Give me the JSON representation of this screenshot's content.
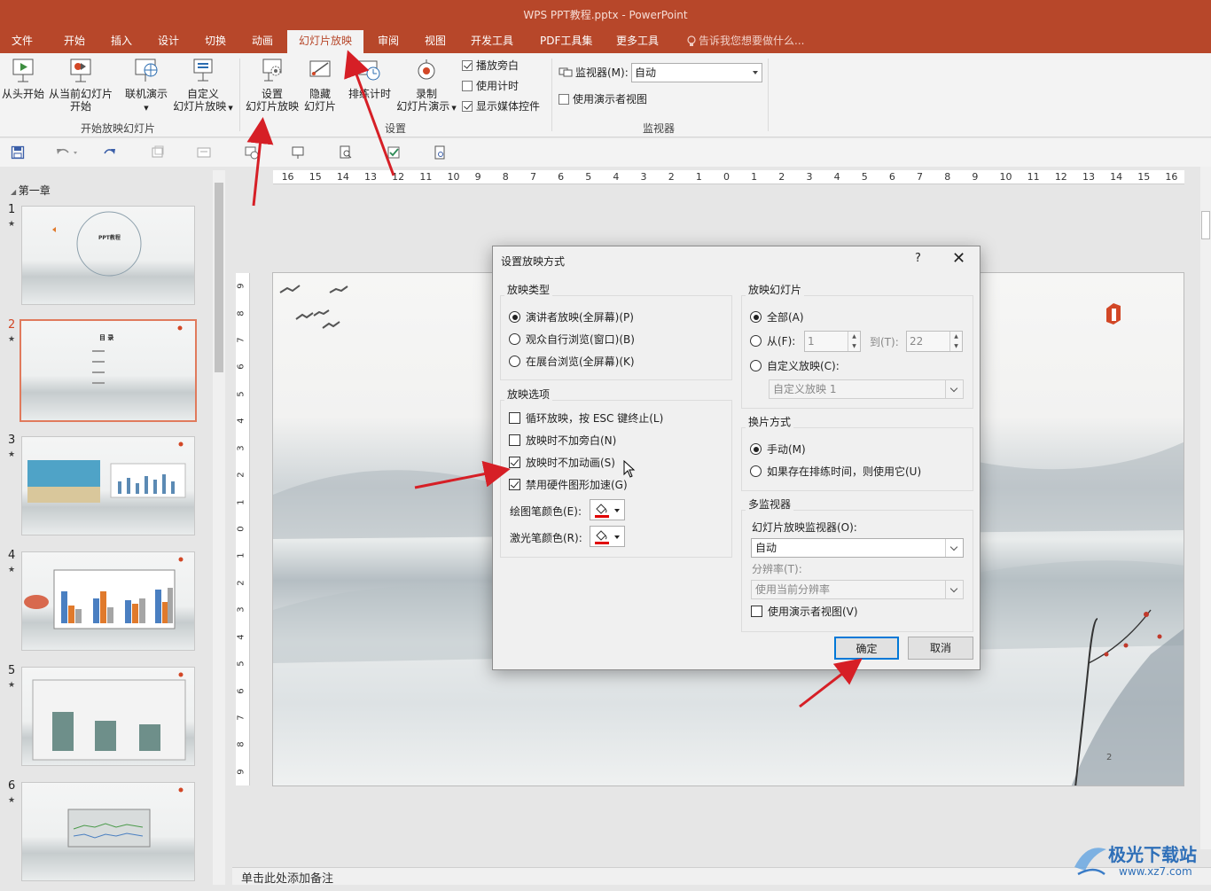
{
  "window": {
    "title": "WPS PPT教程.pptx - PowerPoint"
  },
  "menu": {
    "items": [
      "文件",
      "开始",
      "插入",
      "设计",
      "切换",
      "动画",
      "幻灯片放映",
      "审阅",
      "视图",
      "开发工具",
      "PDF工具集",
      "更多工具"
    ],
    "active": "幻灯片放映",
    "tellme": "告诉我您想要做什么..."
  },
  "ribbon": {
    "start_group": {
      "from_beginning": "从头开始",
      "from_current_1": "从当前幻灯片",
      "from_current_2": "开始",
      "online": "联机演示",
      "custom_1": "自定义",
      "custom_2": "幻灯片放映",
      "label": "开始放映幻灯片"
    },
    "setup_group": {
      "setup_1": "设置",
      "setup_2": "幻灯片放映",
      "hide_1": "隐藏",
      "hide_2": "幻灯片",
      "rehearse": "排练计时",
      "record_1": "录制",
      "record_2": "幻灯片演示",
      "play_narration": "播放旁白",
      "use_timings": "使用计时",
      "show_media": "显示媒体控件",
      "label": "设置"
    },
    "monitor_group": {
      "monitor_label": "监视器(M):",
      "monitor_value": "自动",
      "presenter_view": "使用演示者视图",
      "label": "监视器"
    }
  },
  "thumbnails": {
    "chapter": "第一章",
    "slides": [
      {
        "num": "1",
        "star": "★"
      },
      {
        "num": "2",
        "star": "★"
      },
      {
        "num": "3",
        "star": "★"
      },
      {
        "num": "4",
        "star": "★"
      },
      {
        "num": "5",
        "star": "★"
      },
      {
        "num": "6",
        "star": "★"
      }
    ],
    "selected": 2,
    "slide1_title": "PPT教程",
    "slide2_title": "目 录"
  },
  "ruler": {
    "h_ticks": [
      "16",
      "15",
      "14",
      "13",
      "12",
      "11",
      "10",
      "9",
      "8",
      "7",
      "6",
      "5",
      "4",
      "3",
      "2",
      "1",
      "0",
      "1",
      "2",
      "3",
      "4",
      "5",
      "6",
      "7",
      "8",
      "9",
      "10",
      "11",
      "12",
      "13",
      "14",
      "15",
      "16"
    ],
    "v_ticks": [
      "9",
      "8",
      "7",
      "6",
      "5",
      "4",
      "3",
      "2",
      "1",
      "0",
      "1",
      "2",
      "3",
      "4",
      "5",
      "6",
      "7",
      "8",
      "9"
    ]
  },
  "slide": {
    "page_number": "2"
  },
  "notes": {
    "placeholder": "单击此处添加备注"
  },
  "dialog": {
    "title": "设置放映方式",
    "help": "?",
    "show_type": {
      "label": "放映类型",
      "opt1": "演讲者放映(全屏幕)(P)",
      "opt2": "观众自行浏览(窗口)(B)",
      "opt3": "在展台浏览(全屏幕)(K)"
    },
    "show_options": {
      "label": "放映选项",
      "loop": "循环放映，按 ESC 键终止(L)",
      "no_narration": "放映时不加旁白(N)",
      "no_animation": "放映时不加动画(S)",
      "disable_hw": "禁用硬件图形加速(G)",
      "pen_color": "绘图笔颜色(E):",
      "laser_color": "激光笔颜色(R):",
      "pen_color_value": "#e00000"
    },
    "show_slides": {
      "label": "放映幻灯片",
      "all": "全部(A)",
      "from": "从(F):",
      "from_value": "1",
      "to": "到(T):",
      "to_value": "22",
      "custom": "自定义放映(C):",
      "custom_value": "自定义放映 1"
    },
    "advance": {
      "label": "换片方式",
      "manual": "手动(M)",
      "timings": "如果存在排练时间，则使用它(U)"
    },
    "multi_monitor": {
      "label": "多监视器",
      "monitor_label": "幻灯片放映监视器(O):",
      "monitor_value": "自动",
      "resolution_label": "分辨率(T):",
      "resolution_value": "使用当前分辨率",
      "presenter_view": "使用演示者视图(V)"
    },
    "ok": "确定",
    "cancel": "取消"
  },
  "watermark": {
    "text": "极光下载站",
    "url": "www.xz7.com"
  },
  "colors": {
    "brand": "#b7472a",
    "accent_arrow": "#d61f26",
    "selected_slide": "#e07a5c",
    "default_button": "#0078d7"
  }
}
